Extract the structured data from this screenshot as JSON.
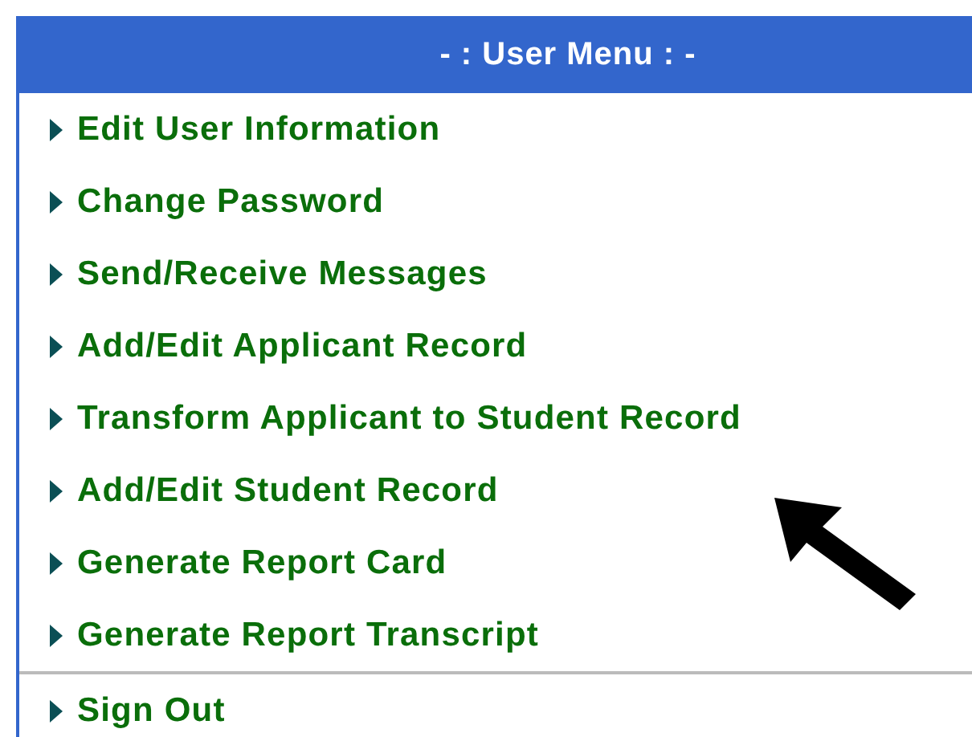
{
  "menu": {
    "title": "- : User Menu : -",
    "groups": [
      {
        "items": [
          {
            "label": "Edit User Information"
          },
          {
            "label": "Change Password"
          },
          {
            "label": "Send/Receive Messages"
          },
          {
            "label": "Add/Edit Applicant Record"
          },
          {
            "label": "Transform Applicant to Student Record"
          },
          {
            "label": "Add/Edit Student Record"
          },
          {
            "label": "Generate Report Card"
          },
          {
            "label": "Generate Report Transcript"
          }
        ]
      },
      {
        "items": [
          {
            "label": "Sign Out"
          }
        ]
      }
    ]
  }
}
